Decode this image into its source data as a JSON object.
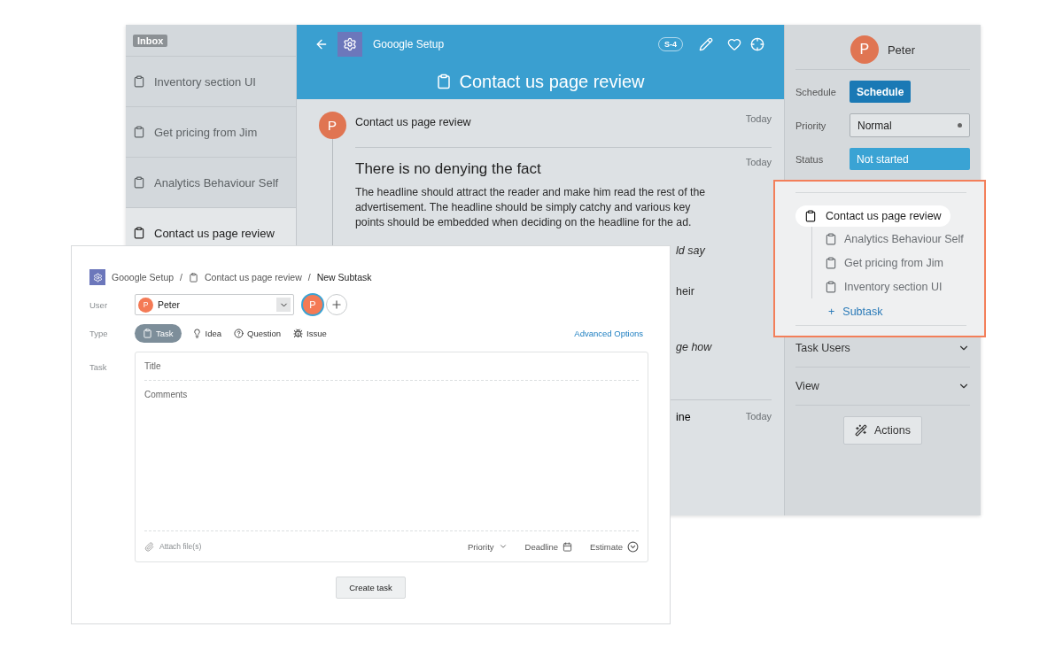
{
  "sidebar": {
    "badge": "Inbox",
    "items": [
      {
        "label": "Inventory section UI",
        "selected": false
      },
      {
        "label": "Get pricing from Jim",
        "selected": false
      },
      {
        "label": "Analytics Behaviour Self",
        "selected": false
      },
      {
        "label": "Contact us page review",
        "selected": true
      }
    ]
  },
  "task_header": {
    "project": "Gooogle Setup",
    "badge": "S-4",
    "title": "Contact us page review"
  },
  "feed": {
    "author_initial": "P",
    "entry": {
      "text": "Contact us page review",
      "time": "Today"
    },
    "article": {
      "heading": "There is no denying the fact",
      "time": "Today",
      "paragraph": "The headline should attract the reader and make him read the rest of the advertisement. The headline should be simply catchy and various key points should be embedded when deciding on the headline for the ad."
    },
    "fragments": [
      {
        "text": "ld say",
        "italic": true
      },
      {
        "text": "heir",
        "italic": false
      },
      {
        "text": "ge how",
        "italic": true
      }
    ],
    "last_entry": {
      "text": "ine",
      "time": "Today"
    }
  },
  "details": {
    "user": {
      "initial": "P",
      "name": "Peter"
    },
    "fields": [
      {
        "label": "Schedule",
        "value": "Schedule",
        "kind": "button"
      },
      {
        "label": "Priority",
        "value": "Normal",
        "kind": "select"
      },
      {
        "label": "Status",
        "value": "Not started",
        "kind": "status"
      }
    ],
    "sections": [
      {
        "label": "Task Users",
        "expanded": false
      },
      {
        "label": "View",
        "expanded": false
      }
    ],
    "action": "Actions"
  },
  "subtask_tree": {
    "label": "Contact us page review",
    "selected": true,
    "children": [
      {
        "label": "Analytics Behaviour Self",
        "selected": false
      },
      {
        "label": "Get pricing from Jim",
        "selected": false
      },
      {
        "label": "Inventory section UI",
        "selected": false
      }
    ],
    "add_icon": "+",
    "add_label": "Subtask"
  },
  "dialog": {
    "breadcrumb": [
      "Gooogle Setup",
      "Contact us page review",
      "New Subtask"
    ],
    "separator": "/",
    "user_label": "User",
    "user": {
      "initial": "P",
      "name": "Peter"
    },
    "assignee_initial": "P",
    "type_label": "Type",
    "types": [
      {
        "label": "Task",
        "kind": "task",
        "selected": true
      },
      {
        "label": "Idea",
        "kind": "idea",
        "selected": false
      },
      {
        "label": "Question",
        "kind": "question",
        "selected": false
      },
      {
        "label": "Issue",
        "kind": "issue",
        "selected": false
      }
    ],
    "advanced_link": "Advanced Options",
    "task_label": "Task",
    "title_placeholder": "Title",
    "comments_placeholder": "Comments",
    "attach_placeholder": "Attach file(s)",
    "options": [
      {
        "label": "Priority",
        "kind": "dropdown"
      },
      {
        "label": "Deadline",
        "kind": "date"
      },
      {
        "label": "Estimate",
        "kind": "time"
      }
    ],
    "submit": "Create task"
  }
}
